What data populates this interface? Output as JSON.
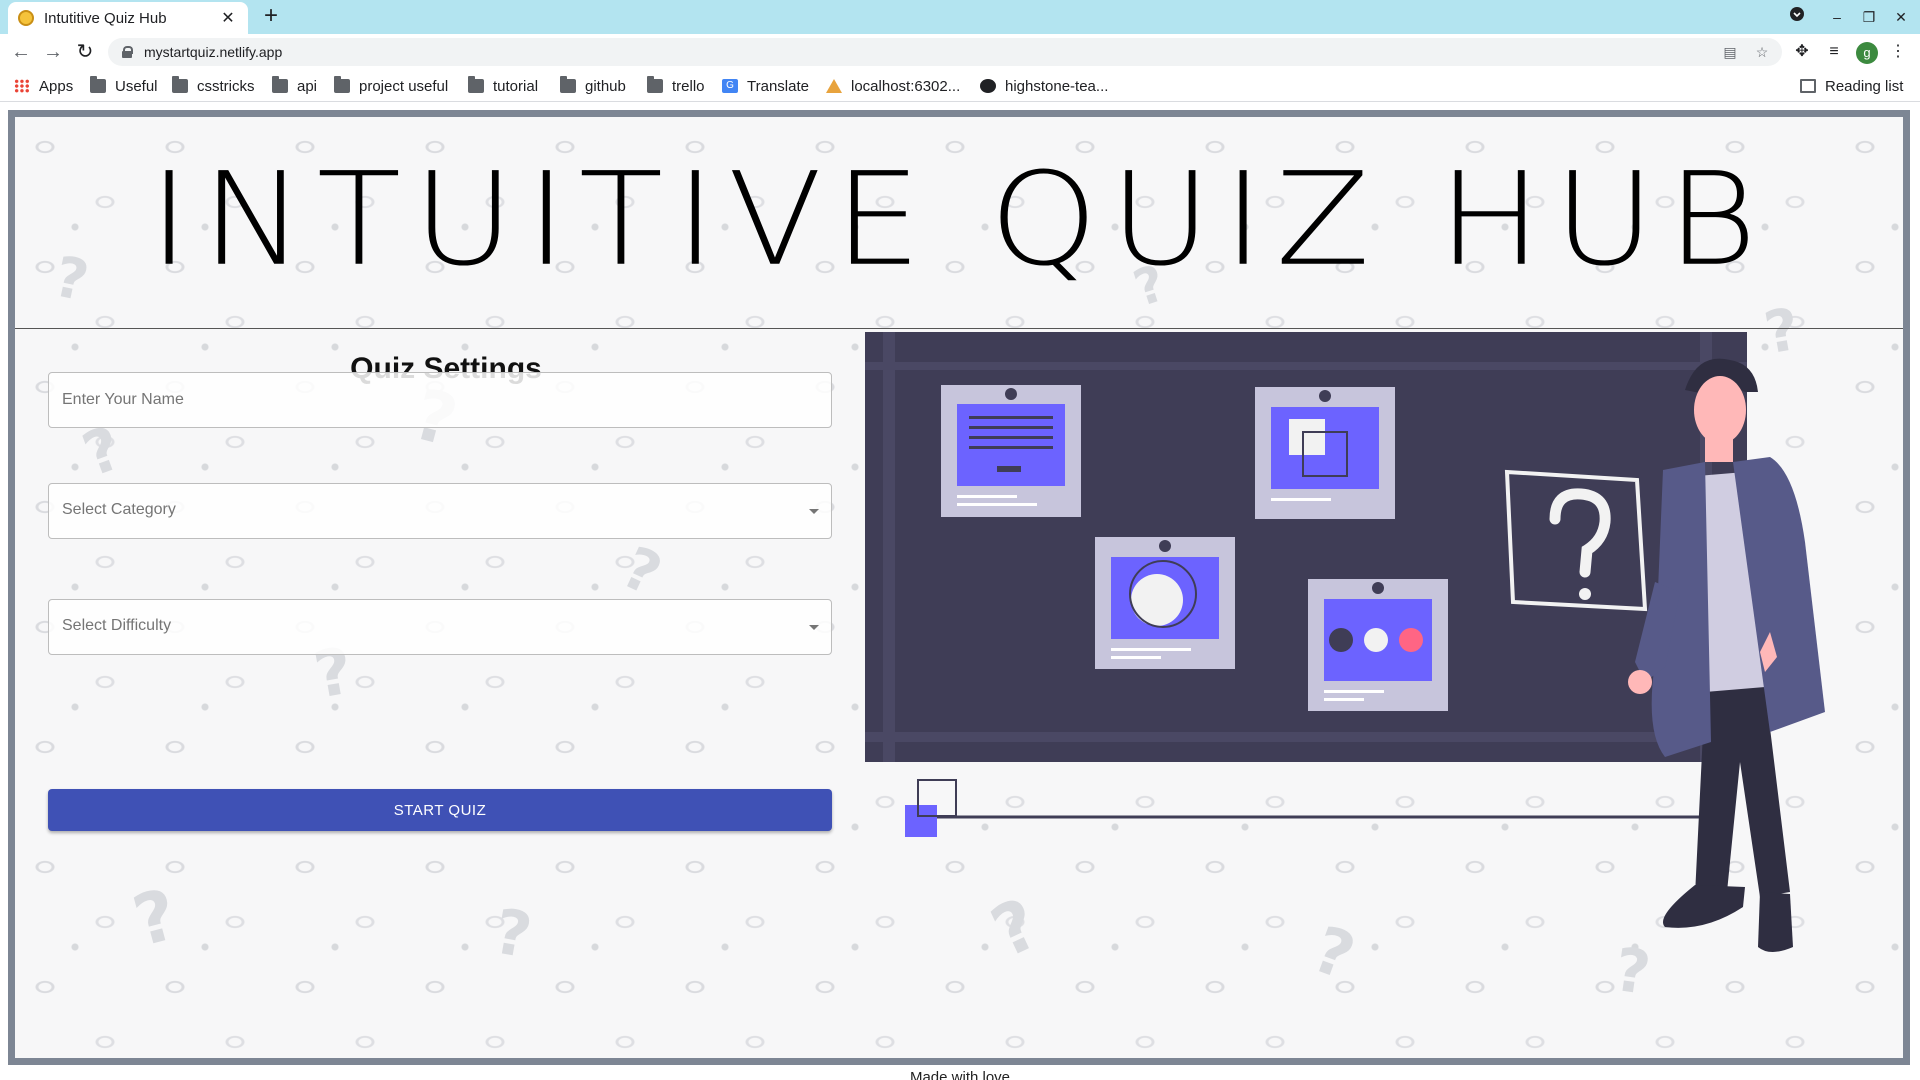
{
  "browser": {
    "tab_title": "Intutitive Quiz Hub",
    "url": "mystartquiz.netlify.app",
    "profile_initial": "g",
    "bookmarks": [
      {
        "label": "Apps",
        "icon": "apps-grid-icon"
      },
      {
        "label": "Useful",
        "icon": "folder-icon"
      },
      {
        "label": "csstricks",
        "icon": "folder-icon"
      },
      {
        "label": "api",
        "icon": "folder-icon"
      },
      {
        "label": "project useful",
        "icon": "folder-icon"
      },
      {
        "label": "tutorial",
        "icon": "folder-icon"
      },
      {
        "label": "github",
        "icon": "folder-icon"
      },
      {
        "label": "trello",
        "icon": "folder-icon"
      },
      {
        "label": "Translate",
        "icon": "translate-icon"
      },
      {
        "label": "localhost:6302...",
        "icon": "warning-icon"
      },
      {
        "label": "highstone-tea...",
        "icon": "github-icon"
      }
    ],
    "reading_list": "Reading list"
  },
  "page": {
    "title": "INTUITIVE QUIZ HUB",
    "settings_heading": "Quiz Settings",
    "name_placeholder": "Enter Your Name",
    "category_placeholder": "Select Category",
    "difficulty_placeholder": "Select Difficulty",
    "start_label": "START QUIZ",
    "footer_partial": "Made with love"
  },
  "colors": {
    "accent": "#3f51b5",
    "board": "#3f3d56",
    "card_accent": "#6c63ff",
    "tab_strip": "#b3e4f0"
  }
}
